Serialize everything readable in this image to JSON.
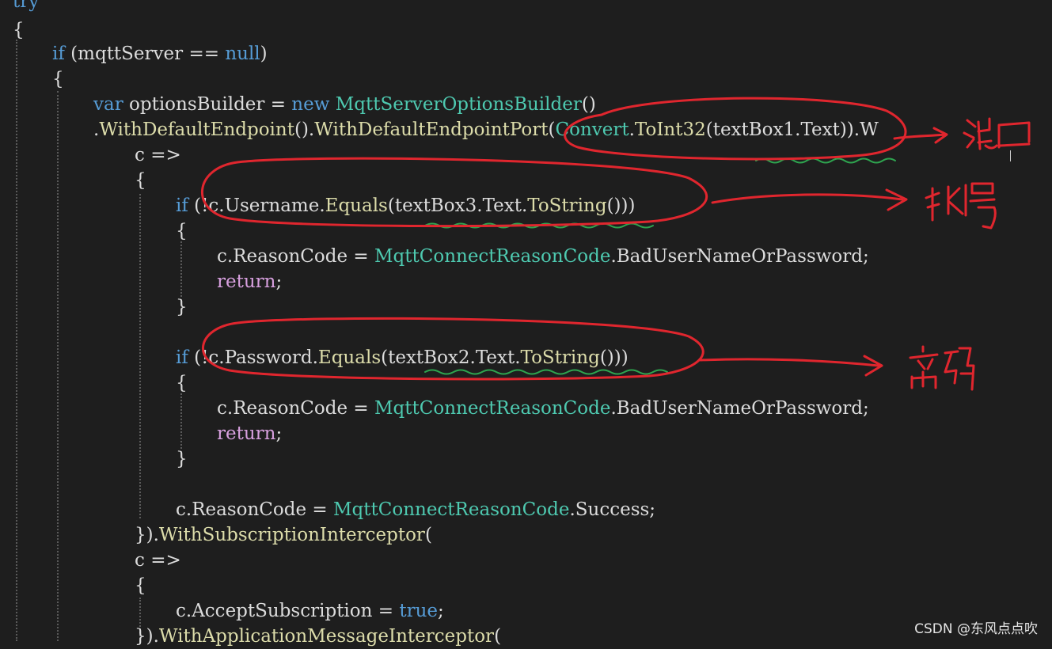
{
  "code": {
    "top": "try",
    "l2": "{",
    "l3": [
      "if",
      " (mqttServer == ",
      "null",
      ")"
    ],
    "l4": "{",
    "l5": [
      "var",
      " optionsBuilder = ",
      "new",
      " ",
      "MqttServerOptionsBuilder",
      "()"
    ],
    "l6": [
      ".",
      "WithDefaultEndpoint",
      "().",
      "WithDefaultEndpointPort",
      "(",
      "Convert",
      ".",
      "ToInt32",
      "(textBox1.Text)).W"
    ],
    "l7": "c =>",
    "l8": "{",
    "l9": [
      "if",
      " (!c.Username.",
      "Equals",
      "(textBox3.Text.",
      "ToString",
      "()))"
    ],
    "l10": "{",
    "l11": [
      "c.ReasonCode = ",
      "MqttConnectReasonCode",
      ".BadUserNameOrPassword;"
    ],
    "l12": [
      "return",
      ";"
    ],
    "l13": "}",
    "l15": [
      "if",
      " (!c.Password.",
      "Equals",
      "(textBox2.Text.",
      "ToString",
      "()))"
    ],
    "l16": "{",
    "l17": [
      "c.ReasonCode = ",
      "MqttConnectReasonCode",
      ".BadUserNameOrPassword;"
    ],
    "l18": [
      "return",
      ";"
    ],
    "l19": "}",
    "l21": [
      "c.ReasonCode = ",
      "MqttConnectReasonCode",
      ".Success;"
    ],
    "l22": [
      "}).",
      "WithSubscriptionInterceptor",
      "("
    ],
    "l23": "c =>",
    "l24": "{",
    "l25": [
      "c.AcceptSubscription = ",
      "true",
      ";"
    ],
    "l26": [
      "}).",
      "WithApplicationMessageInterceptor",
      "("
    ]
  },
  "annotations": {
    "port": "端口",
    "account": "帐号",
    "password": "密码"
  },
  "watermark": "CSDN @东风点点吹",
  "colors": {
    "keyword": "#569cd6",
    "type": "#4ec9b0",
    "method": "#dcdcaa",
    "control": "#d8a0df",
    "ink": "#e0262e",
    "squiggle": "#2ea44f"
  }
}
